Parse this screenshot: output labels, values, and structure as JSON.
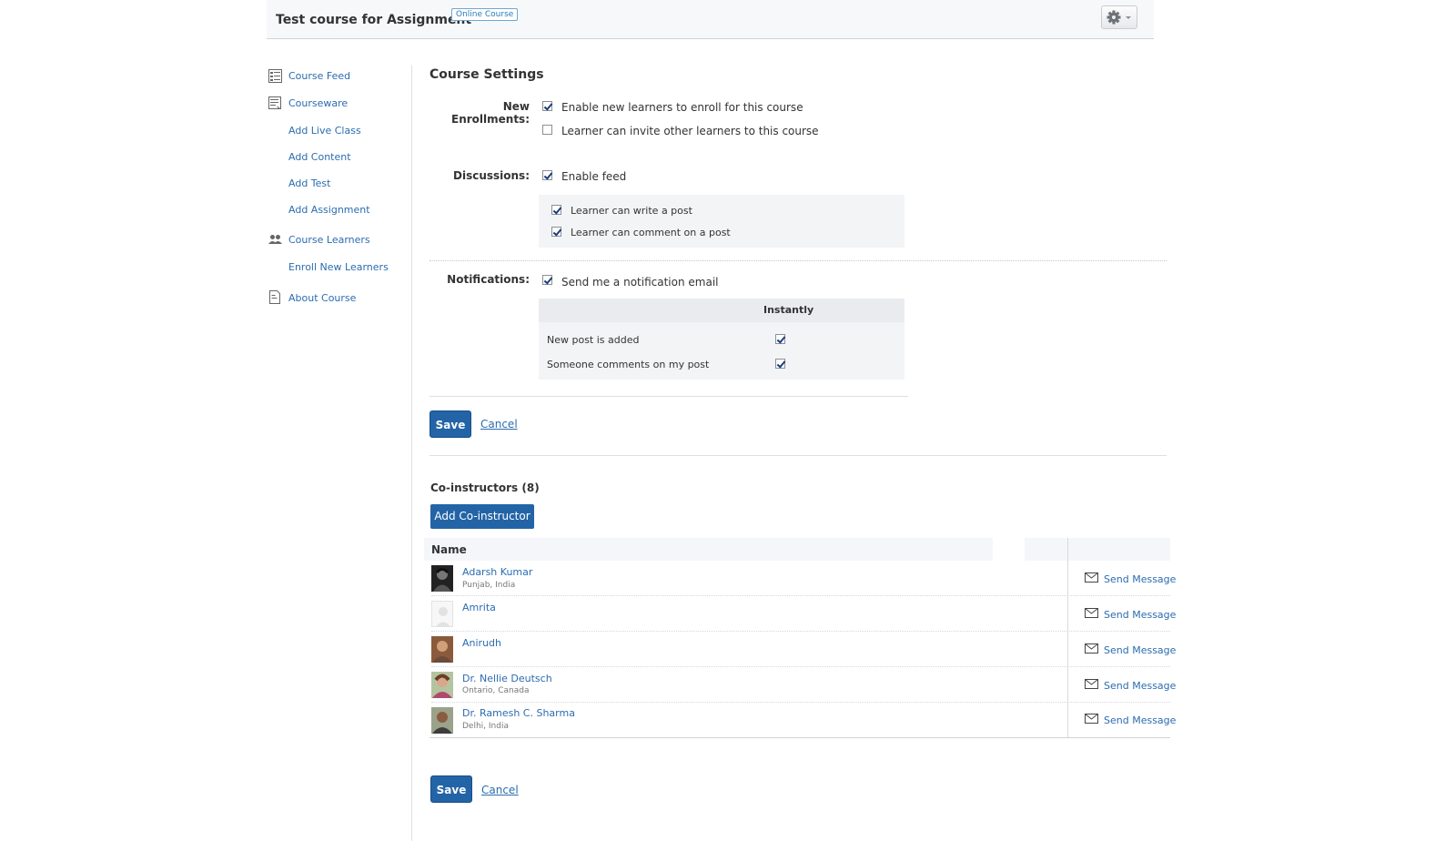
{
  "header": {
    "course_title": "Test course for Assignment",
    "course_badge": "Online Course",
    "settings_icon": "gear-icon"
  },
  "sidebar": {
    "items": [
      {
        "label": "Course Feed",
        "icon": "feed-icon"
      },
      {
        "label": "Courseware",
        "icon": "courseware-icon"
      },
      {
        "label": "Add Live Class"
      },
      {
        "label": "Add Content"
      },
      {
        "label": "Add Test"
      },
      {
        "label": "Add Assignment"
      },
      {
        "label": "Course Learners",
        "icon": "people-icon"
      },
      {
        "label": "Enroll New Learners"
      },
      {
        "label": "About Course",
        "icon": "document-icon"
      }
    ]
  },
  "settings": {
    "title": "Course Settings",
    "enrollments": {
      "label": "New Enrollments:",
      "options": [
        {
          "label": "Enable new learners to enroll for this course",
          "checked": true
        },
        {
          "label": "Learner can invite other learners to this course",
          "checked": false
        }
      ]
    },
    "discussions": {
      "label": "Discussions:",
      "enable_feed": {
        "label": "Enable feed",
        "checked": true
      },
      "sub_options": [
        {
          "label": "Learner can write a post",
          "checked": true
        },
        {
          "label": "Learner can comment on a post",
          "checked": true
        }
      ]
    },
    "notifications": {
      "label": "Notifications:",
      "send_email": {
        "label": "Send me a notification email",
        "checked": true
      },
      "column_header": "Instantly",
      "rows": [
        {
          "label": "New post is added",
          "checked": true
        },
        {
          "label": "Someone comments on my post",
          "checked": true
        }
      ]
    },
    "save_label": "Save",
    "cancel_label": "Cancel"
  },
  "coinstructors": {
    "title": "Co-instructors (8)",
    "add_button": "Add Co-instructor",
    "column_name": "Name",
    "send_message_label": "Send Message",
    "list": [
      {
        "name": "Adarsh Kumar",
        "location": "Punjab, India"
      },
      {
        "name": "Amrita",
        "location": ""
      },
      {
        "name": "Anirudh",
        "location": ""
      },
      {
        "name": "Dr. Nellie Deutsch",
        "location": "Ontario, Canada"
      },
      {
        "name": "Dr. Ramesh C. Sharma",
        "location": "Delhi, India"
      }
    ]
  },
  "footer": {
    "save_label": "Save",
    "cancel_label": "Cancel"
  },
  "colors": {
    "primary_button": "#2364a7",
    "link": "#2b6cb0"
  }
}
